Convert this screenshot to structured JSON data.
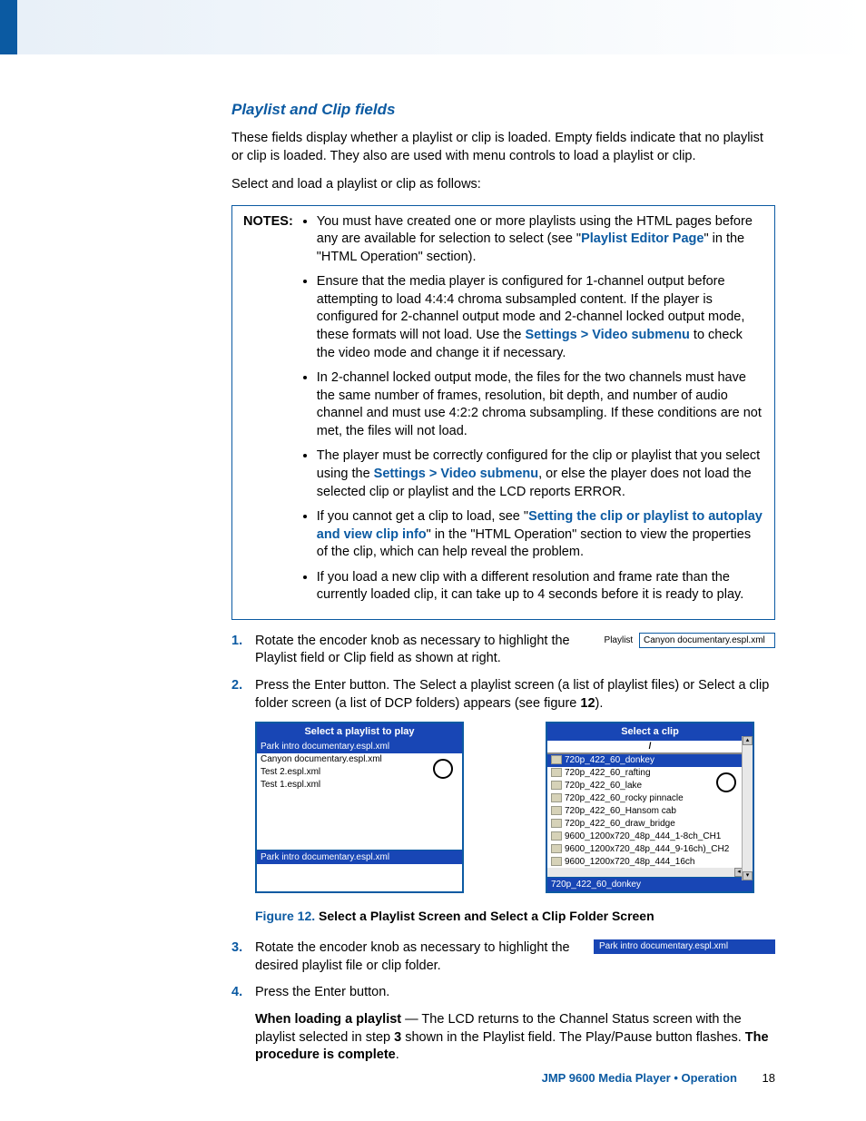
{
  "section_title": "Playlist and Clip fields",
  "intro_p1": "These fields display whether a playlist or clip is loaded. Empty fields indicate that no playlist or clip is loaded. They also are used with menu controls to load a playlist or clip.",
  "intro_p2": "Select and load a playlist or clip as follows:",
  "notes_label": "NOTES:",
  "notes": {
    "n1a": "You must have created one or more playlists using the HTML pages before any are available for selection to select (see \"",
    "n1_link": "Playlist Editor Page",
    "n1b": "\" in the \"HTML Operation\" section).",
    "n2a": "Ensure that the media player is configured for 1-channel output before attempting to load 4:4:4 chroma subsampled content. If the player is configured for 2-channel output mode and 2-channel locked output mode, these formats will not load. Use the ",
    "n2_link": "Settings > Video submenu",
    "n2b": " to check the video mode and change it if necessary.",
    "n3": "In 2-channel locked output mode, the files for the two channels must have the same number of frames, resolution, bit depth, and number of audio channel and must use 4:2:2 chroma subsampling. If these conditions are not met, the files will not load.",
    "n4a": "The player must be correctly configured for the clip or playlist that you select using the ",
    "n4_link": "Settings > Video submenu",
    "n4b": ", or else the player does not load the selected clip or playlist and the LCD reports ERROR.",
    "n5a": "If you cannot get a clip to load, see \"",
    "n5_link": "Setting the clip or playlist to autoplay and view clip info",
    "n5b": "\" in the \"HTML Operation\" section to view the properties of the clip, which can help reveal the problem.",
    "n6": "If you load a new clip with a different resolution and frame rate than the currently loaded clip, it can take up to 4 seconds before it is ready to play."
  },
  "steps": {
    "s1": "Rotate the encoder knob as necessary to highlight the Playlist field or Clip field as shown at right.",
    "s1_field_label": "Playlist",
    "s1_field_value": "Canyon documentary.espl.xml",
    "s2a": "Press the Enter button. The Select a playlist screen (a list of playlist files) or Select a clip folder screen (a list of DCP folders) appears (see figure ",
    "s2_fig": "12",
    "s2b": ").",
    "s3": "Rotate the encoder knob as necessary to highlight the desired playlist file or clip folder.",
    "s3_bar": "Park intro documentary.espl.xml",
    "s4": "Press the Enter button.",
    "s4_p_bold1": "When loading a playlist",
    "s4_p_a": " — The LCD returns to the Channel Status screen with the playlist selected in step ",
    "s4_p_step": "3",
    "s4_p_b": " shown in the Playlist field. The Play/Pause button flashes. ",
    "s4_p_bold2": "The procedure is complete",
    "s4_p_c": "."
  },
  "playlist_screen": {
    "title": "Select a playlist to play",
    "items": [
      "Park intro documentary.espl.xml",
      "Canyon documentary.espl.xml",
      "Test 2.espl.xml",
      "Test 1.espl.xml"
    ],
    "status": "Park intro documentary.espl.xml"
  },
  "clip_screen": {
    "title": "Select a clip",
    "header": "/",
    "items": [
      "720p_422_60_donkey",
      "720p_422_60_rafting",
      "720p_422_60_lake",
      "720p_422_60_rocky pinnacle",
      "720p_422_60_Hansom cab",
      "720p_422_60_draw_bridge",
      "9600_1200x720_48p_444_1-8ch_CH1",
      "9600_1200x720_48p_444_9-16ch)_CH2",
      "9600_1200x720_48p_444_16ch"
    ],
    "status": "720p_422_60_donkey"
  },
  "figure_caption_label": "Figure 12.",
  "figure_caption_text": "Select a Playlist Screen and Select a Clip Folder Screen",
  "footer_text": "JMP 9600 Media Player • Operation",
  "page_number": "18"
}
